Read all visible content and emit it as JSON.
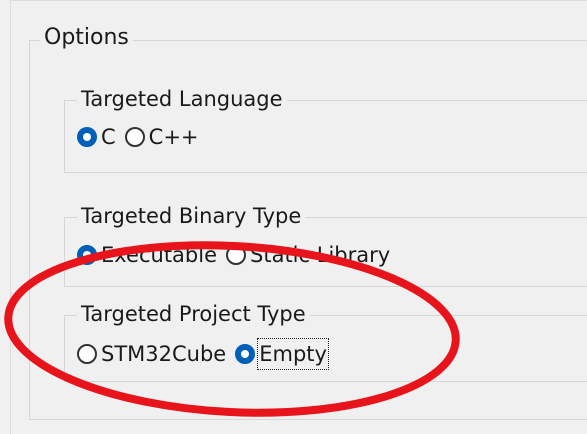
{
  "options": {
    "legend": "Options",
    "language": {
      "legend": "Targeted Language",
      "choices": [
        {
          "label": "C",
          "checked": true
        },
        {
          "label": "C++",
          "checked": false
        }
      ]
    },
    "binary": {
      "legend": "Targeted Binary Type",
      "choices": [
        {
          "label": "Executable",
          "checked": true
        },
        {
          "label": "Static Library",
          "checked": false
        }
      ]
    },
    "project": {
      "legend": "Targeted Project Type",
      "choices": [
        {
          "label": "STM32Cube",
          "checked": false
        },
        {
          "label": "Empty",
          "checked": true,
          "focused": true
        }
      ]
    }
  },
  "annotation": {
    "shape": "ellipse",
    "color": "#e8141b"
  },
  "colors": {
    "background": "#f0f0f0",
    "radio_accent": "#005fb8",
    "group_border": "#d6d6d6"
  }
}
